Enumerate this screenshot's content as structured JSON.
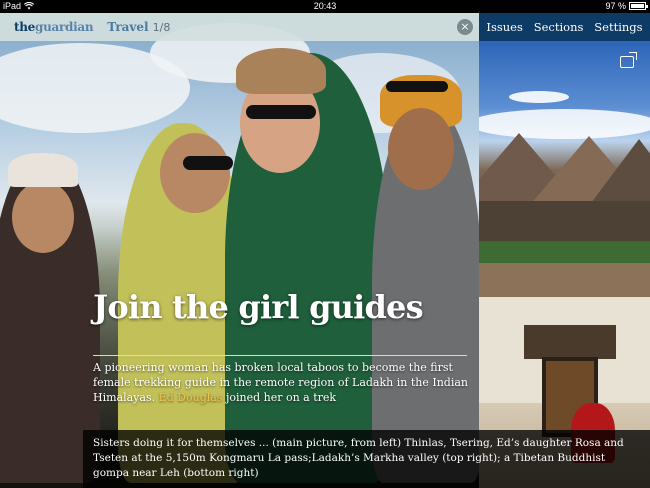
{
  "status_bar": {
    "carrier": "iPad",
    "time": "20:43",
    "battery": "97 %",
    "battery_level": 0.97
  },
  "top_bar": {
    "logo_the": "the",
    "logo_guardian": "guardian",
    "section": "Travel",
    "pager": "1/8",
    "close_label": "×"
  },
  "right_nav": {
    "items": [
      "Issues",
      "Sections",
      "Settings"
    ]
  },
  "article": {
    "headline": "Join the girl guides",
    "standfirst": "A pioneering woman has broken local taboos to become the first female trekking guide in the remote region of Ladakh in the Indian Himalayas.",
    "byline": "Ed Douglas",
    "standfirst_tail": " joined her on a trek",
    "caption": "Sisters doing it for themselves ... (main picture, from left) Thinlas, Tsering, Ed’s daughter Rosa and Tseten at the 5,150m Kongmaru La pass;Ladakh’s Markha valley (top right); a Tibetan Buddhist gompa near Leh (bottom right)"
  },
  "icons": {
    "wifi": "wifi-icon",
    "close": "close-icon",
    "share": "share-icon"
  },
  "colors": {
    "topbar_bg": "#d2dfde",
    "rightnav_bg": "#0d3b66",
    "byline": "#f4c24a",
    "section": "#4c7aa0"
  }
}
